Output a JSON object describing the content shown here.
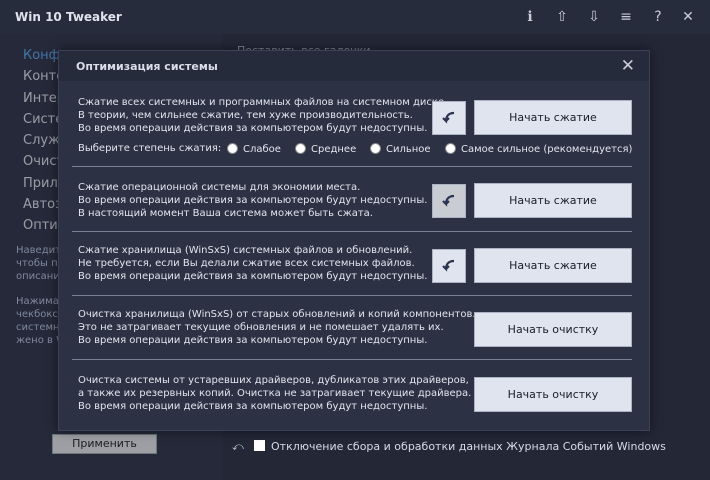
{
  "app": {
    "title": "Win 10 Tweaker"
  },
  "titlebar_icons": [
    "info-icon",
    "upload-icon",
    "download-icon",
    "sort-icon",
    "help-icon",
    "close-icon"
  ],
  "titlebar_glyphs": {
    "info": "ℹ",
    "upload": "⇧",
    "download": "⇩",
    "sort": "≡",
    "help": "?",
    "close": "✕"
  },
  "sidebar": {
    "items": [
      {
        "label": "Конф"
      },
      {
        "label": "Конте"
      },
      {
        "label": "Интер"
      },
      {
        "label": "Систе"
      },
      {
        "label": "Служб"
      },
      {
        "label": "Очист"
      },
      {
        "label": "Прило"
      },
      {
        "label": "Автоз"
      },
      {
        "label": "Оптим"
      }
    ],
    "desc1": [
      "Наведит",
      "чтобы по",
      "описани"
    ],
    "desc2": [
      "Нажимая",
      "чекбокс",
      "системн",
      "жено в W"
    ],
    "apply": "Применить"
  },
  "main": {
    "select_all": "Поставить все галочки",
    "bottom_option": "Отключение сбора и обработки данных Журнала Событий Windows"
  },
  "dialog": {
    "title": "Оптимизация системы",
    "close_glyph": "✕",
    "sections": [
      {
        "lines": [
          "Сжатие всех системных и программных файлов на системном диске.",
          "В теории, чем сильнее сжатие, тем хуже производительность.",
          "Во время операции действия за компьютером будут недоступны."
        ],
        "button": "Начать сжатие"
      },
      {
        "lines": [
          "Сжатие операционной системы для экономии места.",
          "Во время операции действия за компьютером будут недоступны.",
          "В настоящий момент Ваша система может быть сжата."
        ],
        "button": "Начать сжатие"
      },
      {
        "lines": [
          "Сжатие хранилища (WinSxS) системных файлов и обновлений.",
          "Не требуется, если Вы делали сжатие всех системных файлов.",
          "Во время операции действия за компьютером будут недоступны."
        ],
        "button": "Начать сжатие"
      },
      {
        "lines": [
          "Очистка хранилища (WinSxS) от старых обновлений и копий компонентов.",
          "Это не затрагивает текущие обновления и не помешает удалять их.",
          "Во время операции действия за компьютером будут недоступны."
        ],
        "button": "Начать очистку"
      },
      {
        "lines": [
          "Очистка системы от устаревших драйверов, дубликатов этих драйверов,",
          "а также их резервных копий. Очистка не затрагивает текущие драйвера.",
          "Во время операции действия за компьютером будут недоступны."
        ],
        "button": "Начать очистку"
      }
    ],
    "level": {
      "label": "Выберите степень сжатия:",
      "options": [
        "Слабое",
        "Среднее",
        "Сильное",
        "Самое сильное (рекомендуется)"
      ]
    }
  }
}
